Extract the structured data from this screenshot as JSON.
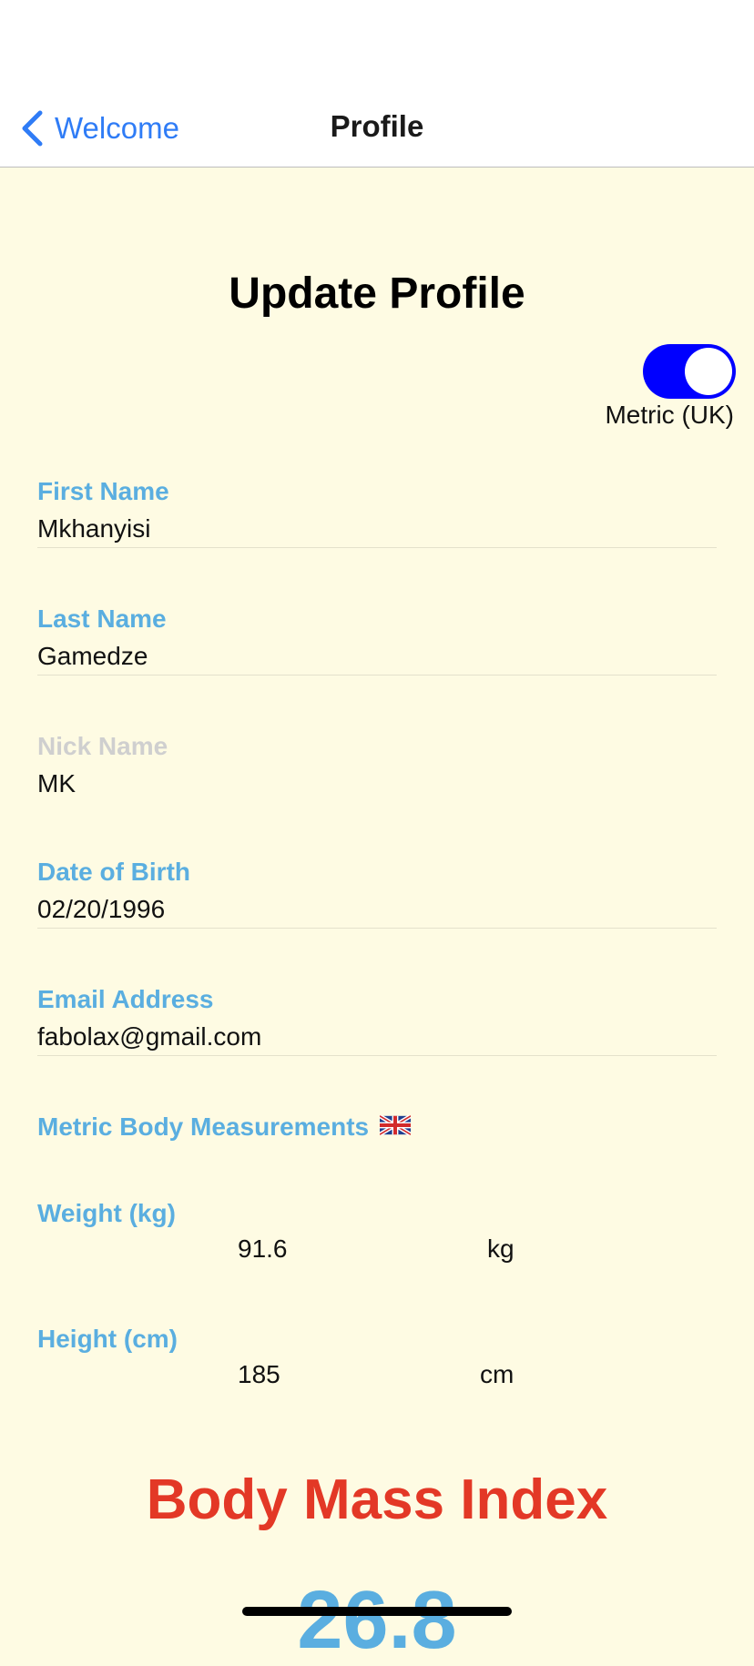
{
  "nav": {
    "back_label": "Welcome",
    "title": "Profile"
  },
  "page_title": "Update Profile",
  "units_toggle": {
    "label": "Metric (UK)",
    "on": true
  },
  "fields": {
    "first_name": {
      "label": "First Name",
      "value": "Mkhanyisi"
    },
    "last_name": {
      "label": "Last Name",
      "value": "Gamedze"
    },
    "nick_name": {
      "label": "Nick Name",
      "value": "MK"
    },
    "date_of_birth": {
      "label": "Date of Birth",
      "value": "02/20/1996"
    },
    "email": {
      "label": "Email Address",
      "value": "fabolax@gmail.com"
    }
  },
  "measurements": {
    "section_label": "Metric Body Measurements",
    "flag_icon": "uk-flag-icon",
    "weight": {
      "label": "Weight  (kg)",
      "value": "91.6",
      "unit": "kg"
    },
    "height": {
      "label": "Height  (cm)",
      "value": "185",
      "unit": "cm"
    }
  },
  "bmi": {
    "title": "Body Mass Index",
    "value": "26.8"
  },
  "colors": {
    "accent_blue": "#2f7cf6",
    "label_blue": "#5aaee0",
    "toggle_on": "#0000ff",
    "bmi_red": "#e33826",
    "background": "#fefbe3"
  }
}
